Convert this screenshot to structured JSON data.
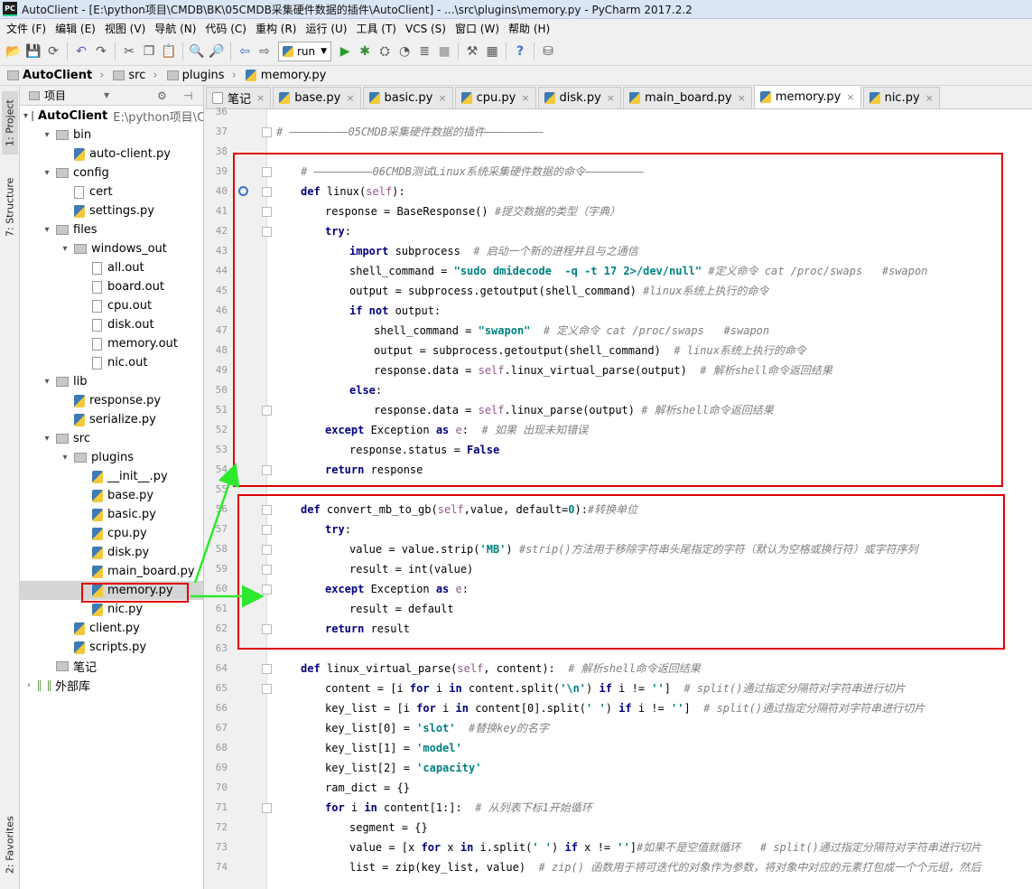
{
  "window": {
    "title": "AutoClient - [E:\\python项目\\CMDB\\BK\\05CMDB采集硬件数据的插件\\AutoClient] - ...\\src\\plugins\\memory.py - PyCharm 2017.2.2",
    "logo": "PC"
  },
  "menu": [
    "文件 (F)",
    "编辑 (E)",
    "视图 (V)",
    "导航 (N)",
    "代码 (C)",
    "重构 (R)",
    "运行 (U)",
    "工具 (T)",
    "VCS (S)",
    "窗口 (W)",
    "帮助 (H)"
  ],
  "toolbar": {
    "run_config": "run"
  },
  "breadcrumb": [
    "AutoClient",
    "src",
    "plugins",
    "memory.py"
  ],
  "side_tabs": {
    "project": "1: Project",
    "structure": "7: Structure",
    "favorites": "2: Favorites"
  },
  "project_panel": {
    "header": "项目"
  },
  "tree": [
    {
      "label": "AutoClient",
      "extra": "E:\\python项目\\C",
      "type": "folder",
      "level": 0,
      "exp": true
    },
    {
      "label": "bin",
      "type": "folder",
      "level": 1,
      "exp": true
    },
    {
      "label": "auto-client.py",
      "type": "py",
      "level": 2
    },
    {
      "label": "config",
      "type": "folder",
      "level": 1,
      "exp": true
    },
    {
      "label": "cert",
      "type": "txt",
      "level": 2
    },
    {
      "label": "settings.py",
      "type": "py",
      "level": 2
    },
    {
      "label": "files",
      "type": "folder",
      "level": 1,
      "exp": true
    },
    {
      "label": "windows_out",
      "type": "folder",
      "level": 2,
      "exp": true
    },
    {
      "label": "all.out",
      "type": "txt",
      "level": 3
    },
    {
      "label": "board.out",
      "type": "txt",
      "level": 3
    },
    {
      "label": "cpu.out",
      "type": "txt",
      "level": 3
    },
    {
      "label": "disk.out",
      "type": "txt",
      "level": 3
    },
    {
      "label": "memory.out",
      "type": "txt",
      "level": 3
    },
    {
      "label": "nic.out",
      "type": "txt",
      "level": 3
    },
    {
      "label": "lib",
      "type": "folder",
      "level": 1,
      "exp": true
    },
    {
      "label": "response.py",
      "type": "py",
      "level": 2
    },
    {
      "label": "serialize.py",
      "type": "py",
      "level": 2
    },
    {
      "label": "src",
      "type": "folder",
      "level": 1,
      "exp": true
    },
    {
      "label": "plugins",
      "type": "folder",
      "level": 2,
      "exp": true
    },
    {
      "label": "__init__.py",
      "type": "py",
      "level": 3
    },
    {
      "label": "base.py",
      "type": "py",
      "level": 3
    },
    {
      "label": "basic.py",
      "type": "py",
      "level": 3
    },
    {
      "label": "cpu.py",
      "type": "py",
      "level": 3
    },
    {
      "label": "disk.py",
      "type": "py",
      "level": 3
    },
    {
      "label": "main_board.py",
      "type": "py",
      "level": 3
    },
    {
      "label": "memory.py",
      "type": "py",
      "level": 3,
      "selected": true
    },
    {
      "label": "nic.py",
      "type": "py",
      "level": 3
    },
    {
      "label": "client.py",
      "type": "py",
      "level": 2
    },
    {
      "label": "scripts.py",
      "type": "py",
      "level": 2
    },
    {
      "label": "笔记",
      "type": "folder",
      "level": 1
    },
    {
      "label": "外部库",
      "type": "lib",
      "level": 0,
      "exp": false
    }
  ],
  "tabs": [
    {
      "label": "笔记",
      "icon": "txt"
    },
    {
      "label": "base.py"
    },
    {
      "label": "basic.py"
    },
    {
      "label": "cpu.py"
    },
    {
      "label": "disk.py"
    },
    {
      "label": "main_board.py"
    },
    {
      "label": "memory.py",
      "active": true
    },
    {
      "label": "nic.py"
    }
  ],
  "code": [
    {
      "n": "36",
      "s": []
    },
    {
      "n": "37",
      "s": [
        [
          "cm",
          "# —————————05CMDB采集硬件数据的插件—————————"
        ]
      ],
      "ind": 0
    },
    {
      "n": "38",
      "s": []
    },
    {
      "n": "39",
      "s": [
        [
          "cm",
          "# —————————06CMDB测试Linux系统采集硬件数据的命令—————————"
        ]
      ],
      "ind": 1
    },
    {
      "n": "40",
      "s": [
        [
          "kw",
          "def "
        ],
        [
          "",
          "linux("
        ],
        [
          "se",
          "self"
        ],
        [
          "",
          "):"
        ]
      ],
      "ind": 1
    },
    {
      "n": "41",
      "s": [
        [
          "",
          "response = BaseResponse() "
        ],
        [
          "cm",
          "#提交数据的类型（字典）"
        ]
      ],
      "ind": 2
    },
    {
      "n": "42",
      "s": [
        [
          "kw",
          "try"
        ],
        [
          "",
          ":"
        ]
      ],
      "ind": 2
    },
    {
      "n": "43",
      "s": [
        [
          "kw",
          "import "
        ],
        [
          "",
          "subprocess  "
        ],
        [
          "cm",
          "# 启动一个新的进程并且与之通信"
        ]
      ],
      "ind": 3
    },
    {
      "n": "44",
      "s": [
        [
          "",
          "shell_command = "
        ],
        [
          "st",
          "\"sudo dmidecode  -q -t 17 2>/dev/null\""
        ],
        [
          "cm",
          " #定义命令 cat /proc/swaps   #swapon"
        ]
      ],
      "ind": 3
    },
    {
      "n": "45",
      "s": [
        [
          "",
          "output = subprocess.getoutput(shell_command) "
        ],
        [
          "cm",
          "#linux系统上执行的命令"
        ]
      ],
      "ind": 3
    },
    {
      "n": "46",
      "s": [
        [
          "kw",
          "if not "
        ],
        [
          "",
          "output:"
        ]
      ],
      "ind": 3
    },
    {
      "n": "47",
      "s": [
        [
          "",
          "shell_command = "
        ],
        [
          "st",
          "\"swapon\""
        ],
        [
          "cm",
          "  # 定义命令 cat /proc/swaps   #swapon"
        ]
      ],
      "ind": 4
    },
    {
      "n": "48",
      "s": [
        [
          "",
          "output = subprocess.getoutput(shell_command)  "
        ],
        [
          "cm",
          "# linux系统上执行的命令"
        ]
      ],
      "ind": 4
    },
    {
      "n": "49",
      "s": [
        [
          "",
          "response.data = "
        ],
        [
          "se",
          "self"
        ],
        [
          "",
          ".linux_virtual_parse(output)  "
        ],
        [
          "cm",
          "# 解析shell命令返回结果"
        ]
      ],
      "ind": 4
    },
    {
      "n": "50",
      "s": [
        [
          "kw",
          "else"
        ],
        [
          "",
          ":"
        ]
      ],
      "ind": 3
    },
    {
      "n": "51",
      "s": [
        [
          "",
          "response.data = "
        ],
        [
          "se",
          "self"
        ],
        [
          "",
          ".linux_parse(output) "
        ],
        [
          "cm",
          "# 解析shell命令返回结果"
        ]
      ],
      "ind": 4
    },
    {
      "n": "52",
      "s": [
        [
          "kw",
          "except "
        ],
        [
          "",
          "Exception "
        ],
        [
          "kw",
          "as "
        ],
        [
          "se",
          "e"
        ],
        [
          "",
          ":  "
        ],
        [
          "cm",
          "# 如果 出现未知错误"
        ]
      ],
      "ind": 2
    },
    {
      "n": "53",
      "s": [
        [
          "",
          "response.status = "
        ],
        [
          "kw",
          "False"
        ]
      ],
      "ind": 3
    },
    {
      "n": "54",
      "s": [
        [
          "kw",
          "return "
        ],
        [
          "",
          "response"
        ]
      ],
      "ind": 2
    },
    {
      "n": "55",
      "s": []
    },
    {
      "n": "56",
      "s": [
        [
          "kw",
          "def "
        ],
        [
          "",
          "convert_mb_to_gb("
        ],
        [
          "se",
          "self"
        ],
        [
          "",
          ",value, default="
        ],
        [
          "st",
          "0"
        ],
        [
          "",
          "):"
        ],
        [
          "cm",
          "#转换单位"
        ]
      ],
      "ind": 1
    },
    {
      "n": "57",
      "s": [
        [
          "kw",
          "try"
        ],
        [
          "",
          ":"
        ]
      ],
      "ind": 2
    },
    {
      "n": "58",
      "s": [
        [
          "",
          "value = value.strip("
        ],
        [
          "st",
          "'MB'"
        ],
        [
          "",
          ") "
        ],
        [
          "cm",
          "#strip()方法用于移除字符串头尾指定的字符（默认为空格或换行符）或字符序列"
        ]
      ],
      "ind": 3
    },
    {
      "n": "59",
      "s": [
        [
          "",
          "result = int(value)"
        ]
      ],
      "ind": 3
    },
    {
      "n": "60",
      "s": [
        [
          "kw",
          "except "
        ],
        [
          "",
          "Exception "
        ],
        [
          "kw",
          "as "
        ],
        [
          "se",
          "e"
        ],
        [
          "",
          ":"
        ]
      ],
      "ind": 2
    },
    {
      "n": "61",
      "s": [
        [
          "",
          "result = default"
        ]
      ],
      "ind": 3
    },
    {
      "n": "62",
      "s": [
        [
          "kw",
          "return "
        ],
        [
          "",
          "result"
        ]
      ],
      "ind": 2
    },
    {
      "n": "63",
      "s": []
    },
    {
      "n": "64",
      "s": [
        [
          "kw",
          "def "
        ],
        [
          "",
          "linux_virtual_parse("
        ],
        [
          "se",
          "self"
        ],
        [
          "",
          ", content):  "
        ],
        [
          "cm",
          "# 解析shell命令返回结果"
        ]
      ],
      "ind": 1
    },
    {
      "n": "65",
      "s": [
        [
          "",
          "content = [i "
        ],
        [
          "kw",
          "for "
        ],
        [
          "",
          "i "
        ],
        [
          "kw",
          "in "
        ],
        [
          "",
          "content.split("
        ],
        [
          "st",
          "'\\n'"
        ],
        [
          "",
          ") "
        ],
        [
          "kw",
          "if "
        ],
        [
          "",
          "i != "
        ],
        [
          "st",
          "''"
        ],
        [
          "",
          "]  "
        ],
        [
          "cm",
          "# split()通过指定分隔符对字符串进行切片"
        ]
      ],
      "ind": 2
    },
    {
      "n": "66",
      "s": [
        [
          "",
          "key_list = [i "
        ],
        [
          "kw",
          "for "
        ],
        [
          "",
          "i "
        ],
        [
          "kw",
          "in "
        ],
        [
          "",
          "content[0].split("
        ],
        [
          "st",
          "' '"
        ],
        [
          "",
          ") "
        ],
        [
          "kw",
          "if "
        ],
        [
          "",
          "i != "
        ],
        [
          "st",
          "''"
        ],
        [
          "",
          "]  "
        ],
        [
          "cm",
          "# split()通过指定分隔符对字符串进行切片"
        ]
      ],
      "ind": 2
    },
    {
      "n": "67",
      "s": [
        [
          "",
          "key_list[0] = "
        ],
        [
          "st",
          "'slot'"
        ],
        [
          "cm",
          "  #替换key的名字"
        ]
      ],
      "ind": 2
    },
    {
      "n": "68",
      "s": [
        [
          "",
          "key_list[1] = "
        ],
        [
          "st",
          "'model'"
        ]
      ],
      "ind": 2
    },
    {
      "n": "69",
      "s": [
        [
          "",
          "key_list[2] = "
        ],
        [
          "st",
          "'capacity'"
        ]
      ],
      "ind": 2
    },
    {
      "n": "70",
      "s": [
        [
          "",
          "ram_dict = {}"
        ]
      ],
      "ind": 2
    },
    {
      "n": "71",
      "s": [
        [
          "kw",
          "for "
        ],
        [
          "",
          "i "
        ],
        [
          "kw",
          "in "
        ],
        [
          "",
          "content[1:]:  "
        ],
        [
          "cm",
          "# 从列表下标1开始循环"
        ]
      ],
      "ind": 2
    },
    {
      "n": "72",
      "s": [
        [
          "",
          "segment = {}"
        ]
      ],
      "ind": 3
    },
    {
      "n": "73",
      "s": [
        [
          "",
          "value = [x "
        ],
        [
          "kw",
          "for "
        ],
        [
          "",
          "x "
        ],
        [
          "kw",
          "in "
        ],
        [
          "",
          "i.split("
        ],
        [
          "st",
          "' '"
        ],
        [
          "",
          ") "
        ],
        [
          "kw",
          "if "
        ],
        [
          "",
          "x != "
        ],
        [
          "st",
          "''"
        ],
        [
          "",
          "]"
        ],
        [
          "cm",
          "#如果不是空值就循环   # split()通过指定分隔符对字符串进行切片"
        ]
      ],
      "ind": 3
    },
    {
      "n": "74",
      "s": [
        [
          "",
          "list = zip(key_list, value)  "
        ],
        [
          "cm",
          "# zip() 函数用于将可迭代的对象作为参数，将对象中对应的元素打包成一个个元组，然后"
        ]
      ],
      "ind": 3
    }
  ]
}
